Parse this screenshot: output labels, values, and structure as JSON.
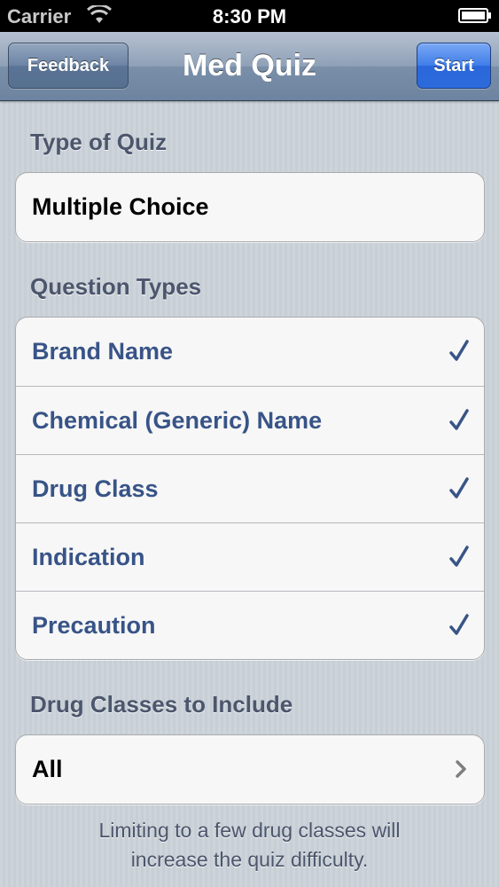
{
  "status_bar": {
    "carrier": "Carrier",
    "time": "8:30 PM",
    "wifi_icon": "wifi-icon",
    "battery_icon": "battery-icon"
  },
  "nav": {
    "title": "Med Quiz",
    "left_button": "Feedback",
    "right_button": "Start"
  },
  "quiz_type": {
    "header": "Type of Quiz",
    "value": "Multiple Choice"
  },
  "question_types": {
    "header": "Question Types",
    "items": [
      {
        "label": "Brand Name",
        "checked": true
      },
      {
        "label": "Chemical (Generic) Name",
        "checked": true
      },
      {
        "label": "Drug Class",
        "checked": true
      },
      {
        "label": "Indication",
        "checked": true
      },
      {
        "label": "Precaution",
        "checked": true
      }
    ]
  },
  "drug_classes": {
    "header": "Drug Classes to Include",
    "value": "All",
    "note_line1": "Limiting to a few drug classes will",
    "note_line2": "increase the quiz difficulty."
  },
  "colors": {
    "accent_blue": "#385487",
    "start_button": "#2a67dc",
    "nav_bar": "#6d84a0"
  }
}
